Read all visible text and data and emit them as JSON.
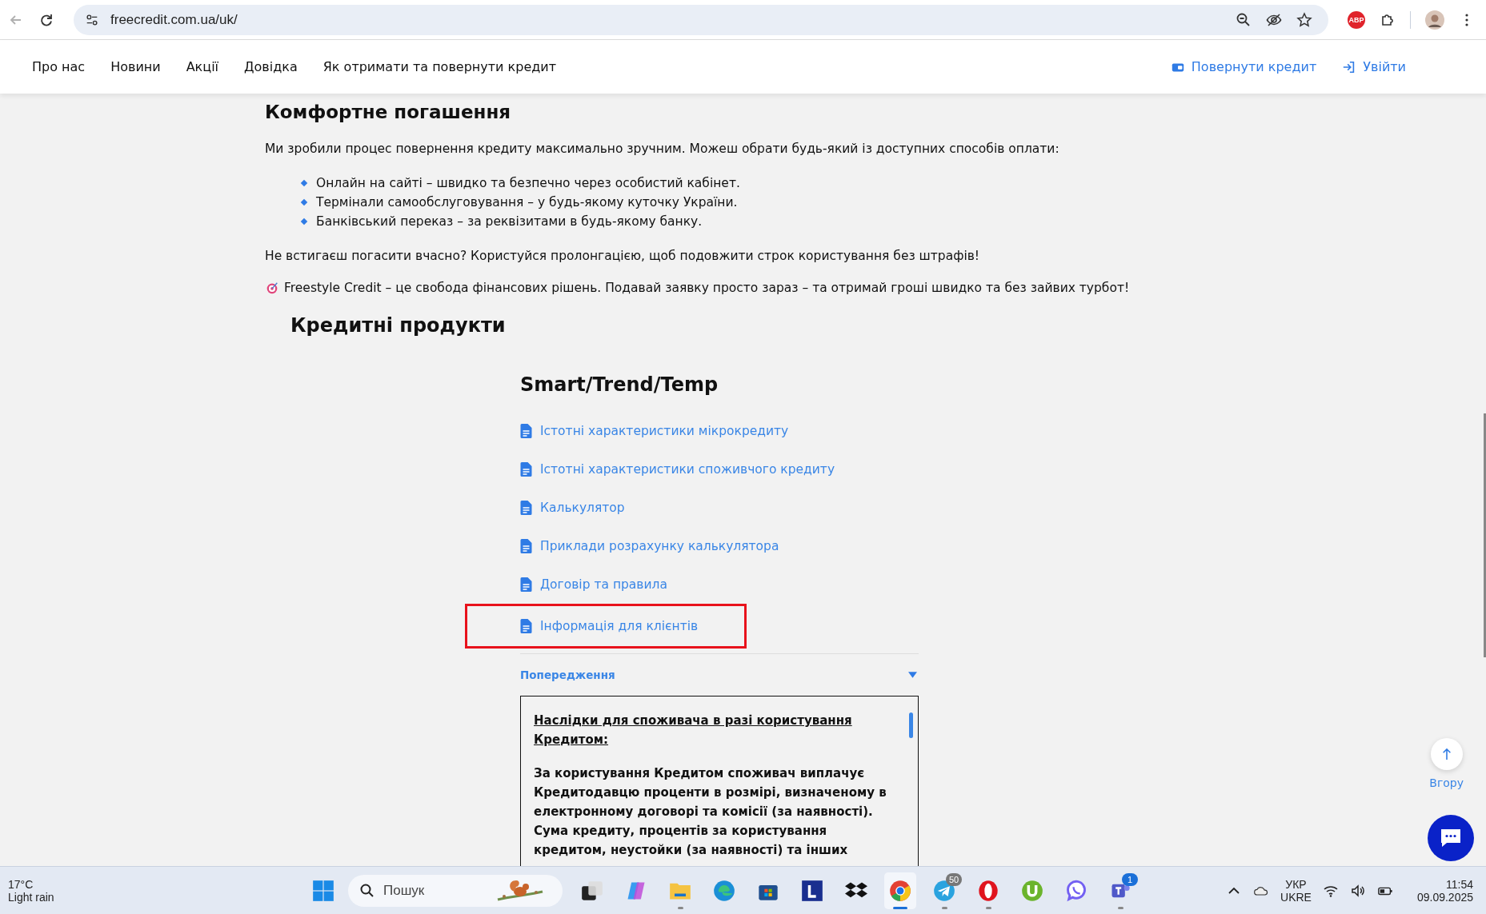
{
  "browser": {
    "url": "freecredit.com.ua/uk/",
    "back_disabled": true,
    "extension_badge": "ABP"
  },
  "nav": {
    "items": [
      "Про нас",
      "Новини",
      "Акції",
      "Довідка",
      "Як отримати та повернути кредит"
    ],
    "actions": [
      {
        "kind": "repay",
        "label": "Повернути кредит"
      },
      {
        "kind": "login",
        "label": "Увійти"
      }
    ]
  },
  "section": {
    "title": "Комфортне погашення",
    "intro": "Ми зробили процес повернення кредиту максимально зручним. Можеш обрати будь-який із доступних способів оплати:",
    "bullets": [
      "Онлайн на сайті – швидко та безпечно через особистий кабінет.",
      "Термінали самообслуговування – у будь-якому куточку України.",
      "Банківський переказ – за реквізитами в будь-якому банку."
    ],
    "note": "Не встигаєш погасити вчасно? Користуйся пролонгацією, щоб подовжити строк користування без штрафів!",
    "promo": "Freestyle Credit – це свобода фінансових рішень. Подавай заявку просто зараз – та отримай гроші швидко та без зайвих турбот!"
  },
  "products": {
    "title": "Кредитні продукти",
    "group_title": "Smart/Trend/Temp",
    "links": [
      {
        "label": "Істотні характеристики мікрокредиту",
        "highlighted": false
      },
      {
        "label": "Істотні характеристики споживчого кредиту",
        "highlighted": false
      },
      {
        "label": "Калькулятор",
        "highlighted": false
      },
      {
        "label": "Приклади розрахунку калькулятора",
        "highlighted": false
      },
      {
        "label": "Договір та правила",
        "highlighted": false
      },
      {
        "label": "Інформація для клієнтів",
        "highlighted": true
      }
    ],
    "warning": {
      "label": "Попередження",
      "expanded": true,
      "heading": "Наслідки для споживача в разі користування Кредитом:",
      "body": "За користування Кредитом споживач виплачує Кредитодавцю проценти в розмірі, визначеному в електронному договорі та комісії (за наявності). Сума кредиту, процентів за користування кредитом, неустойки (за наявності) та інших"
    }
  },
  "scroll_top": {
    "label": "Вгору"
  },
  "taskbar": {
    "weather": {
      "temp": "17°C",
      "condition": "Light rain"
    },
    "search_placeholder": "Пошук",
    "apps": [
      {
        "kind": "taskview",
        "selected": false,
        "running": false
      },
      {
        "kind": "copilot",
        "selected": false,
        "running": false
      },
      {
        "kind": "explorer",
        "selected": false,
        "running": true
      },
      {
        "kind": "edge",
        "selected": false,
        "running": false
      },
      {
        "kind": "store",
        "selected": false,
        "running": false
      },
      {
        "kind": "letter",
        "selected": false,
        "running": false
      },
      {
        "kind": "dropbox",
        "selected": false,
        "running": false
      },
      {
        "kind": "chrome",
        "selected": true,
        "running": true
      },
      {
        "kind": "telegram",
        "selected": false,
        "running": true,
        "badge": "50"
      },
      {
        "kind": "opera",
        "selected": false,
        "running": true
      },
      {
        "kind": "torrent",
        "selected": false,
        "running": false
      },
      {
        "kind": "viber",
        "selected": false,
        "running": false
      },
      {
        "kind": "teams",
        "selected": false,
        "running": true,
        "badge": "1"
      }
    ],
    "language": [
      "УКР",
      "UKRE"
    ],
    "time": "11:54",
    "date": "09.09.2025"
  }
}
